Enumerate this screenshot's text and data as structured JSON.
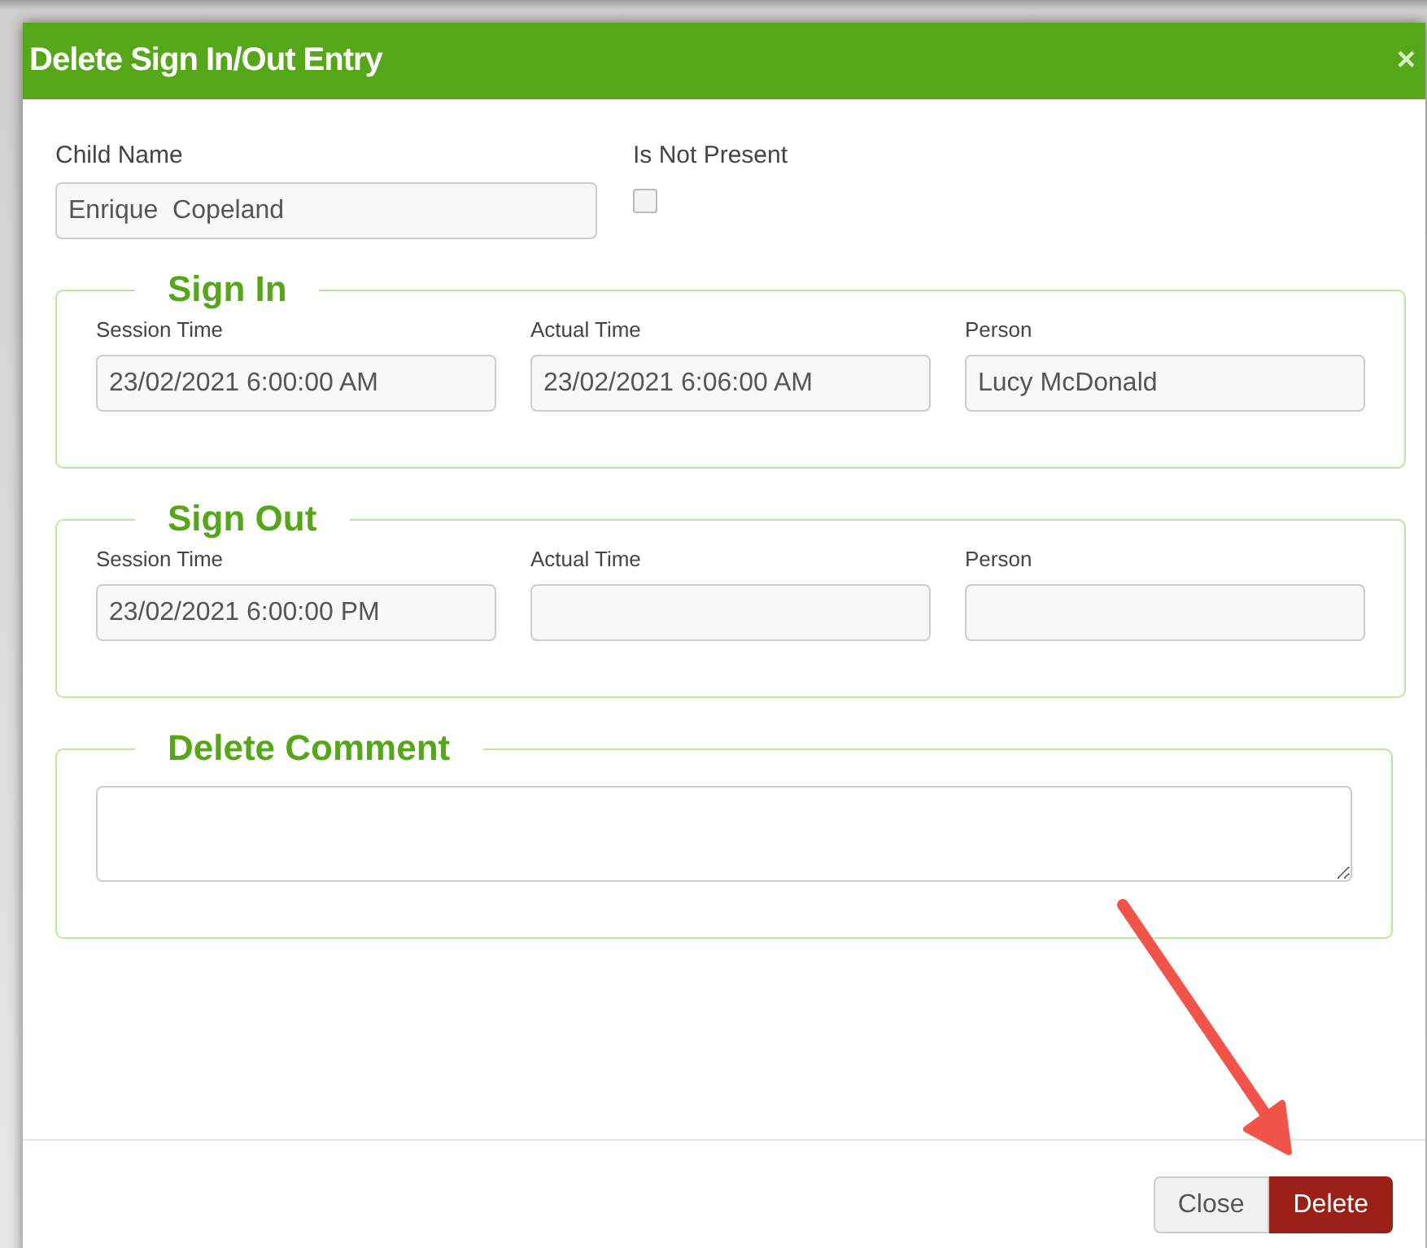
{
  "dialog": {
    "title": "Delete Sign In/Out Entry",
    "close_icon": "×"
  },
  "child_name": {
    "label": "Child Name",
    "value": "Enrique  Copeland"
  },
  "not_present": {
    "label": "Is Not Present",
    "checked": false
  },
  "sections": [
    {
      "legend": "Sign In",
      "kind": "fields",
      "fields": [
        {
          "label": "Session Time",
          "value": "23/02/2021 6:00:00 AM"
        },
        {
          "label": "Actual Time",
          "value": "23/02/2021 6:06:00 AM"
        },
        {
          "label": "Person",
          "value": "Lucy McDonald"
        }
      ]
    },
    {
      "legend": "Sign Out",
      "kind": "fields",
      "fields": [
        {
          "label": "Session Time",
          "value": "23/02/2021 6:00:00 PM"
        },
        {
          "label": "Actual Time"
        },
        {
          "label": "Person"
        }
      ]
    },
    {
      "legend": "Delete Comment",
      "kind": "comment"
    }
  ],
  "buttons": [
    {
      "label": "Close",
      "kind": "default"
    },
    {
      "label": "Delete",
      "kind": "danger"
    }
  ]
}
